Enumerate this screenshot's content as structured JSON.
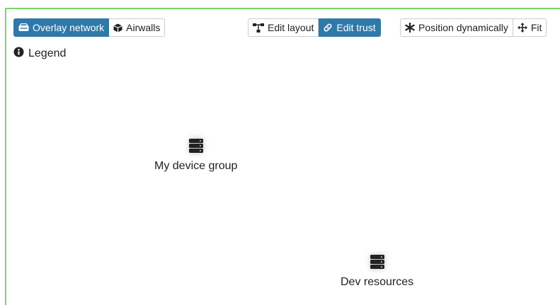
{
  "toolbar": {
    "view_tabs": [
      {
        "label": "Overlay network",
        "icon": "hdd-icon",
        "active": true
      },
      {
        "label": "Airwalls",
        "icon": "cube-icon",
        "active": false
      }
    ],
    "edit_modes": [
      {
        "label": "Edit layout",
        "icon": "sitemap-icon",
        "active": false
      },
      {
        "label": "Edit trust",
        "icon": "link-icon",
        "active": true
      }
    ],
    "layout_actions": [
      {
        "label": "Position dynamically",
        "icon": "asterisk-icon"
      },
      {
        "label": "Fit",
        "icon": "arrows-move-icon"
      }
    ]
  },
  "legend": {
    "label": "Legend",
    "icon": "info-circle-icon"
  },
  "nodes": [
    {
      "label": "My device group",
      "icon": "server-icon"
    },
    {
      "label": "Dev resources",
      "icon": "server-icon"
    }
  ],
  "colors": {
    "accent": "#2f79a9",
    "frame": "#7ed36a"
  }
}
